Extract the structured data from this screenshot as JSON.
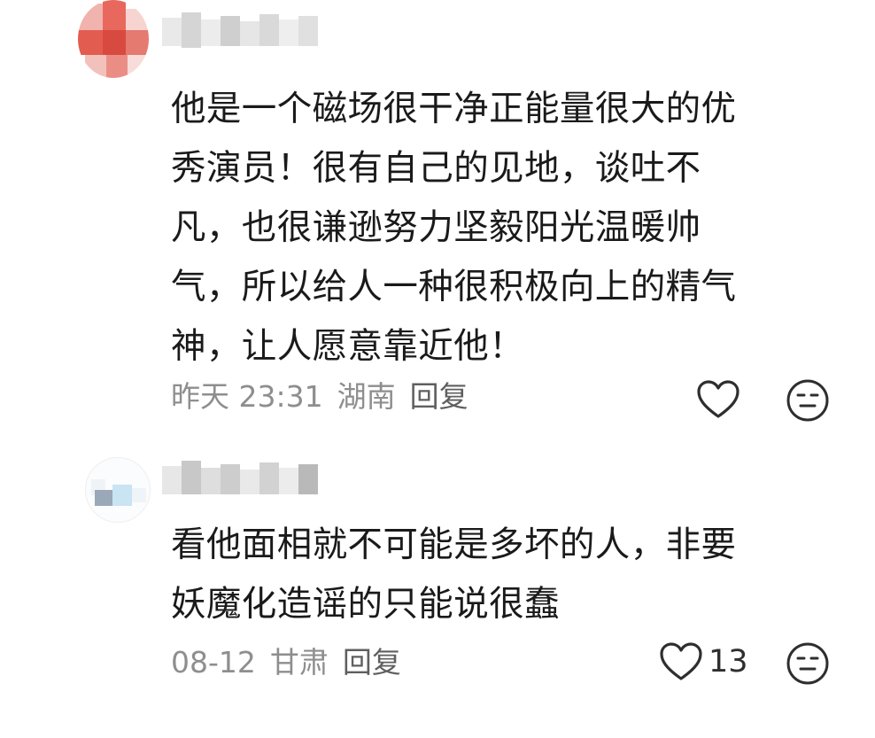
{
  "comments": [
    {
      "lines": [
        "他是一个磁场很干净正能量很大的优",
        "秀演员！很有自己的见地，谈吐不",
        "凡，也很谦逊努力坚毅阳光温暖帅",
        "气，所以给人一种很积极向上的精气",
        "神，让人愿意靠近他！"
      ],
      "date": "昨天 23:31",
      "location": "湖南",
      "reply_label": "回复",
      "like_count": "",
      "icons": {
        "like": "heart-outline-icon",
        "dislike": "neutral-face-icon"
      }
    },
    {
      "lines": [
        "看他面相就不可能是多坏的人，非要",
        "妖魔化造谣的只能说很蠢"
      ],
      "date": "08-12",
      "location": "甘肃",
      "reply_label": "回复",
      "like_count": "13",
      "icons": {
        "like": "heart-outline-icon",
        "dislike": "neutral-face-icon"
      }
    }
  ],
  "colors": {
    "text": "#1a1a1a",
    "meta": "#8e8e8e",
    "reply": "#5f5f5f",
    "icon": "#2e2e2e",
    "background": "#ffffff"
  }
}
